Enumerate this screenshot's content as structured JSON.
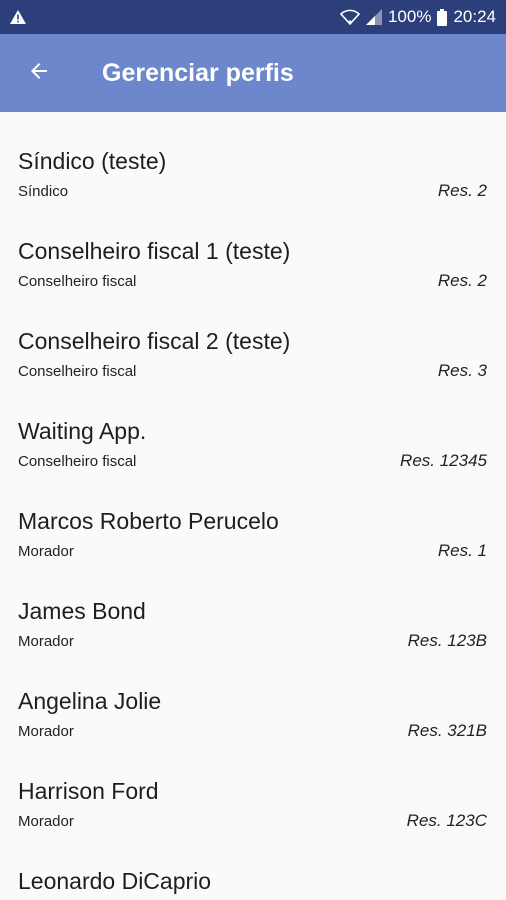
{
  "statusbar": {
    "warning_icon": "warning-triangle-icon",
    "battery": "100%",
    "time": "20:24"
  },
  "appbar": {
    "title": "Gerenciar perfis",
    "back_icon": "arrow-back-icon"
  },
  "colors": {
    "statusbar": "#2c3f7a",
    "appbar": "#6d87cd",
    "background": "#fafafa"
  },
  "profiles": [
    {
      "name": "Síndico (teste)",
      "role": "Síndico",
      "res": "Res. 2"
    },
    {
      "name": "Conselheiro fiscal 1 (teste)",
      "role": "Conselheiro fiscal",
      "res": "Res. 2"
    },
    {
      "name": "Conselheiro fiscal 2 (teste)",
      "role": "Conselheiro fiscal",
      "res": "Res. 3"
    },
    {
      "name": "Waiting App.",
      "role": "Conselheiro fiscal",
      "res": "Res. 12345"
    },
    {
      "name": "Marcos Roberto Perucelo",
      "role": "Morador",
      "res": "Res. 1"
    },
    {
      "name": "James Bond",
      "role": "Morador",
      "res": "Res. 123B"
    },
    {
      "name": "Angelina Jolie",
      "role": "Morador",
      "res": "Res. 321B"
    },
    {
      "name": "Harrison Ford",
      "role": "Morador",
      "res": "Res. 123C"
    },
    {
      "name": "Leonardo DiCaprio",
      "role": "",
      "res": ""
    }
  ]
}
